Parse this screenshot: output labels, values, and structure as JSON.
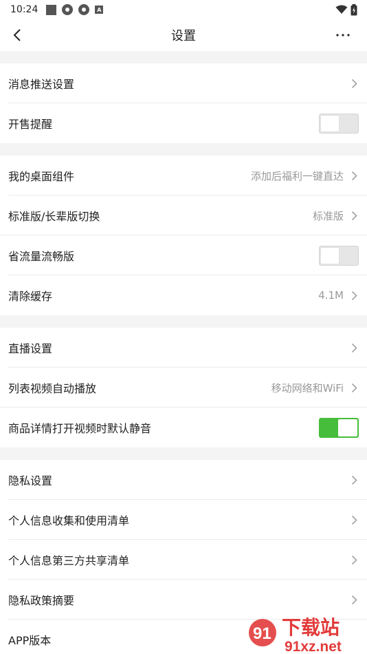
{
  "status_bar": {
    "time": "10:24"
  },
  "header": {
    "title": "设置"
  },
  "groups": [
    {
      "rows": [
        {
          "label": "消息推送设置",
          "type": "link"
        },
        {
          "label": "开售提醒",
          "type": "toggle",
          "on": false
        }
      ]
    },
    {
      "rows": [
        {
          "label": "我的桌面组件",
          "value": "添加后福利一键直达",
          "type": "link"
        },
        {
          "label": "标准版/长辈版切换",
          "value": "标准版",
          "type": "link"
        },
        {
          "label": "省流量流畅版",
          "type": "toggle",
          "on": false
        },
        {
          "label": "清除缓存",
          "value": "4.1M",
          "type": "link"
        }
      ]
    },
    {
      "rows": [
        {
          "label": "直播设置",
          "type": "link"
        },
        {
          "label": "列表视频自动播放",
          "value": "移动网络和WiFi",
          "type": "link"
        },
        {
          "label": "商品详情打开视频时默认静音",
          "type": "toggle",
          "on": true
        }
      ]
    },
    {
      "rows": [
        {
          "label": "隐私设置",
          "type": "link"
        },
        {
          "label": "个人信息收集和使用清单",
          "type": "link"
        },
        {
          "label": "个人信息第三方共享清单",
          "type": "link"
        },
        {
          "label": "隐私政策摘要",
          "type": "link"
        },
        {
          "label": "APP版本",
          "type": "static"
        }
      ]
    }
  ],
  "watermark": {
    "brand": "下载站",
    "domain": "91xz.net",
    "logo_text": "91"
  },
  "colors": {
    "toggle_on": "#46bd3b",
    "group_gap": "#f4f4f4",
    "watermark_red": "#e23b3b"
  }
}
